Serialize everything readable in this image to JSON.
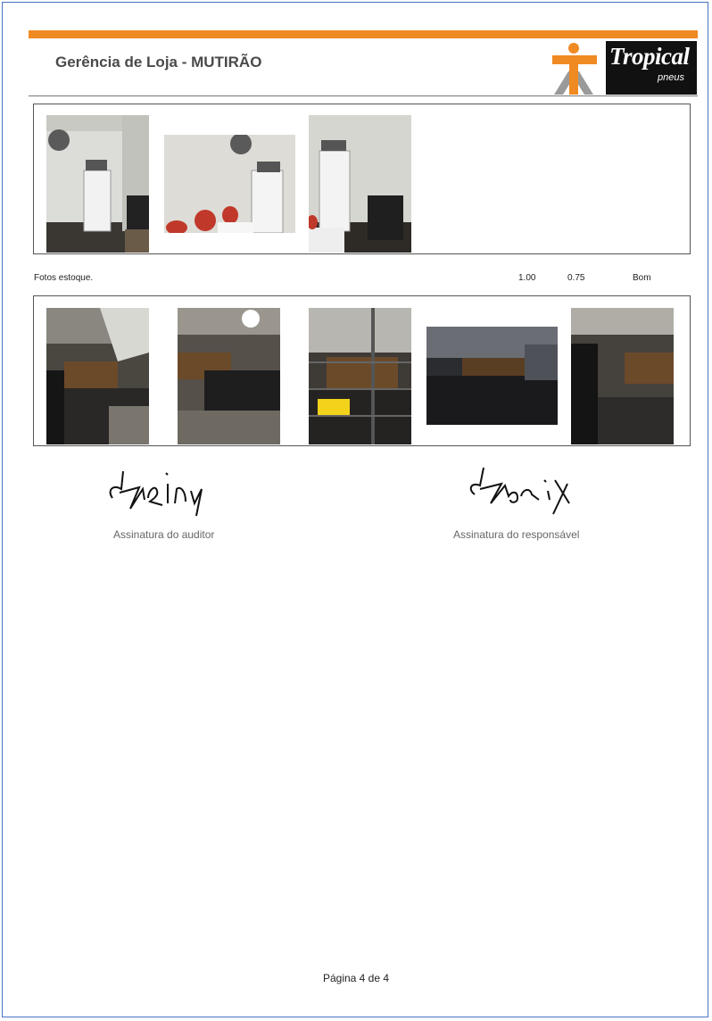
{
  "header": {
    "title": "Gerência de Loja - MUTIRÃO",
    "logo_text": "Tropical",
    "logo_sub": "pneus",
    "accent_color": "#f08a22"
  },
  "item": {
    "description": "Fotos estoque.",
    "value_1": "1.00",
    "value_2": "0.75",
    "rating": "Bom"
  },
  "signatures": {
    "auditor_name": "Kariny",
    "auditor_label": "Assinatura do auditor",
    "responsible_name": "Kariny",
    "responsible_label": "Assinatura do responsável"
  },
  "footer": {
    "page_label": "Página 4 de 4"
  }
}
